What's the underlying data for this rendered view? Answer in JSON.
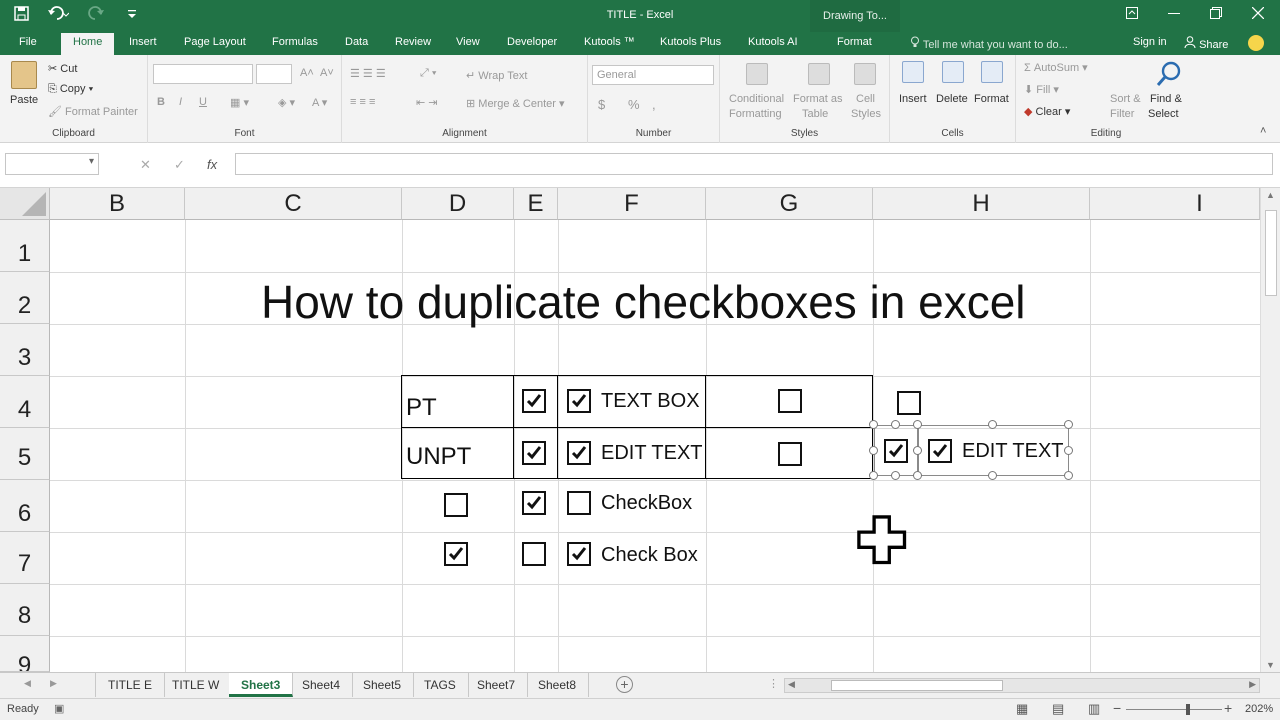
{
  "titlebar": {
    "title": "TITLE - Excel",
    "context_tab": "Drawing To...",
    "icons": [
      "save-icon",
      "undo-icon",
      "redo-icon",
      "customize-qat-icon"
    ]
  },
  "tabs": {
    "items": [
      "File",
      "Home",
      "Insert",
      "Page Layout",
      "Formulas",
      "Data",
      "Review",
      "View",
      "Developer",
      "Kutools ™",
      "Kutools Plus",
      "Kutools AI",
      "Format"
    ],
    "active": "Home",
    "tell_me": "Tell me what you want to do...",
    "sign_in": "Sign in",
    "share": "Share"
  },
  "ribbon": {
    "clipboard": {
      "paste": "Paste",
      "cut": "Cut",
      "copy": "Copy",
      "format_painter": "Format Painter",
      "label": "Clipboard"
    },
    "font": {
      "label": "Font",
      "bold": "B",
      "italic": "I",
      "underline": "U"
    },
    "alignment": {
      "wrap_text": "Wrap Text",
      "merge_center": "Merge & Center",
      "label": "Alignment"
    },
    "number": {
      "format": "General",
      "currency": "$",
      "percent": "%",
      "comma": ",",
      "label": "Number"
    },
    "styles": {
      "conditional": "Conditional",
      "conditional2": "Formatting",
      "format_as": "Format as",
      "format_as2": "Table",
      "cell": "Cell",
      "cell2": "Styles",
      "label": "Styles"
    },
    "cells": {
      "insert": "Insert",
      "delete": "Delete",
      "format": "Format",
      "label": "Cells"
    },
    "editing": {
      "autosum": "AutoSum",
      "fill": "Fill",
      "clear": "Clear",
      "sort": "Sort &",
      "sort2": "Filter",
      "find": "Find &",
      "find2": "Select",
      "label": "Editing"
    }
  },
  "formula_bar": {
    "cancel": "✕",
    "enter": "✓",
    "fx": "fx",
    "value": ""
  },
  "grid": {
    "columns": [
      "B",
      "C",
      "D",
      "E",
      "F",
      "G",
      "H",
      "I"
    ],
    "rows": [
      "1",
      "2",
      "3",
      "4",
      "5",
      "6",
      "7",
      "8",
      "9"
    ]
  },
  "sheet": {
    "title": "How to duplicate checkboxes in excel",
    "d4": "PT",
    "d5": "UNPT",
    "f4": "TEXT BOX",
    "f5": "EDIT TEXT",
    "f6": "CheckBox",
    "f7": "Check Box",
    "selected_label": "EDIT TEXT"
  },
  "checkboxes": {
    "e4": true,
    "f4": true,
    "g4": false,
    "h4": false,
    "e5": true,
    "f5": true,
    "g5": false,
    "d6": false,
    "e6": true,
    "f6": false,
    "d7": true,
    "e7": false,
    "f7": true,
    "sel_a": true,
    "sel_b": true
  },
  "sheet_tabs": [
    "TITLE E",
    "TITLE W",
    "Sheet3",
    "Sheet4",
    "Sheet5",
    "TAGS",
    "Sheet7",
    "Sheet8"
  ],
  "active_sheet": "Sheet3",
  "status": {
    "ready": "Ready",
    "zoom": "202%"
  }
}
